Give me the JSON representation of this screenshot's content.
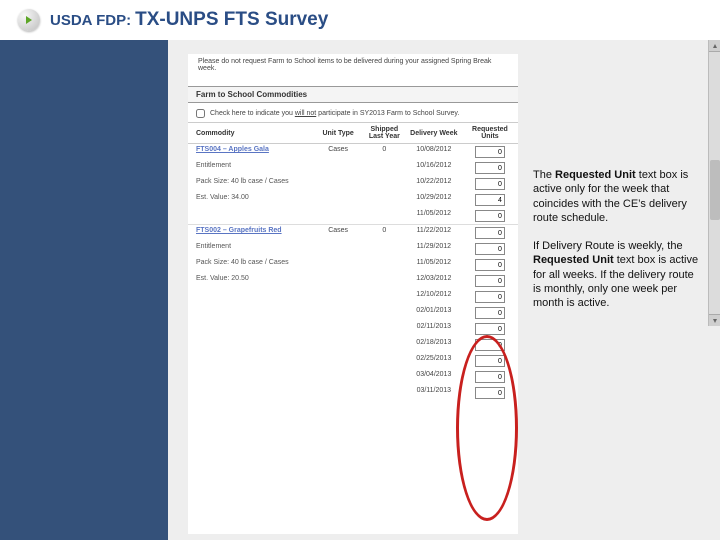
{
  "header": {
    "prefix": "USDA FDP:",
    "title": "TX-UNPS FTS Survey"
  },
  "page": {
    "notice": "Please do not request Farm to School items to be delivered during your assigned Spring Break week.",
    "section_title": "Farm to School Commodities",
    "checkbox_text": "Check here to indicate you ",
    "checkbox_underline": "will not",
    "checkbox_tail": " participate in SY2013 Farm to School Survey.",
    "columns": {
      "commodity": "Commodity",
      "unit_type": "Unit Type",
      "shipped": "Shipped Last Year",
      "delivery": "Delivery Week",
      "requested": "Requested Units"
    }
  },
  "products": [
    {
      "name": "FTS004 – Apples Gala",
      "meta1": "Entitlement",
      "meta2": "Pack Size: 40 lb case / Cases",
      "meta3": "Est. Value: 34.00",
      "unit_type": "Cases",
      "shipped": "0",
      "rows": [
        {
          "week": "10/08/2012",
          "units": "0"
        },
        {
          "week": "10/16/2012",
          "units": "0"
        },
        {
          "week": "10/22/2012",
          "units": "0"
        },
        {
          "week": "10/29/2012",
          "units": "4"
        },
        {
          "week": "11/05/2012",
          "units": "0"
        }
      ]
    },
    {
      "name": "FTS002 – Grapefruits Red",
      "meta1": "Entitlement",
      "meta2": "Pack Size: 40 lb case / Cases",
      "meta3": "Est. Value: 20.50",
      "unit_type": "Cases",
      "shipped": "0",
      "rows": [
        {
          "week": "11/22/2012",
          "units": "0"
        },
        {
          "week": "11/29/2012",
          "units": "0"
        },
        {
          "week": "11/05/2012",
          "units": "0"
        },
        {
          "week": "12/03/2012",
          "units": "0"
        },
        {
          "week": "12/10/2012",
          "units": "0"
        },
        {
          "week": "02/01/2013",
          "units": "0"
        },
        {
          "week": "02/11/2013",
          "units": "0"
        },
        {
          "week": "02/18/2013",
          "units": "0"
        },
        {
          "week": "02/25/2013",
          "units": "0"
        },
        {
          "week": "03/04/2013",
          "units": "0"
        },
        {
          "week": "03/11/2013",
          "units": "0"
        }
      ]
    }
  ],
  "callout": {
    "p1_a": "The ",
    "p1_b": "Requested Unit",
    "p1_c": " text box is active only for  the week that coincides with the CE’s delivery route schedule.",
    "p2_a": "If Delivery Route is weekly, the ",
    "p2_b": "Requested Unit",
    "p2_c": " text box is active for all weeks. If the delivery route is monthly, only one week per month is active."
  }
}
